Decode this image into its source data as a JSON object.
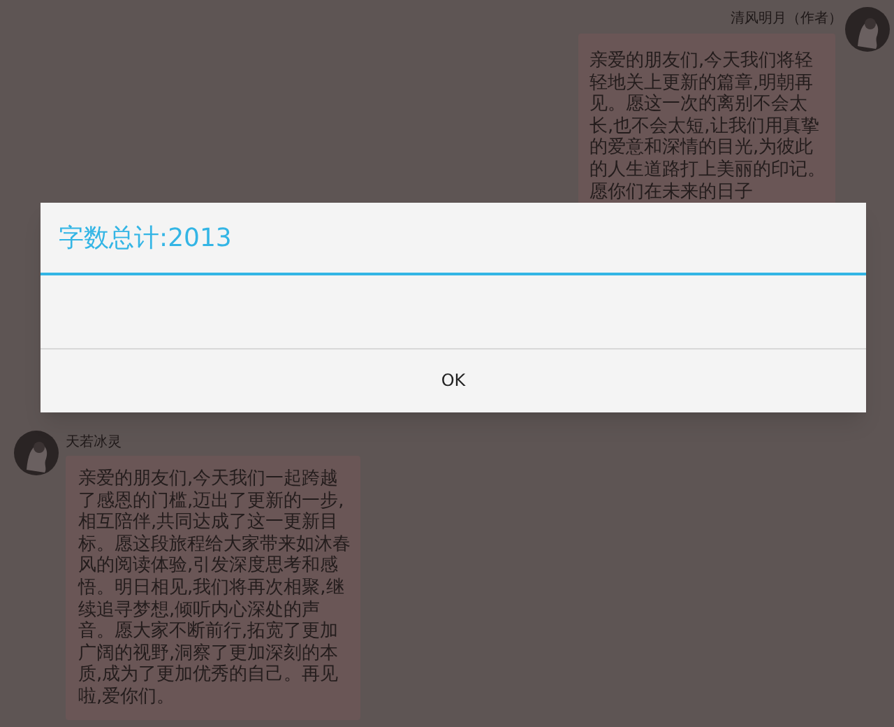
{
  "messages": [
    {
      "kind": "outgoing",
      "author": "清风明月（作者）",
      "text": "亲爱的朋友们,今天我们将轻轻地关上更新的篇章,明朝再见。愿这一次的离别不会太长,也不会太短,让我们用真挚的爱意和深情的目光,为彼此的人生道路打上美丽的印记。愿你们在未来的日子"
    },
    {
      "kind": "incoming",
      "author": "天若冰灵",
      "text": "亲爱的朋友们,今天我们一起跨越了感恩的门槛,迈出了更新的一步,相互陪伴,共同达成了这一更新目标。愿这段旅程给大家带来如沐春风的阅读体验,引发深度思考和感悟。明日相见,我们将再次相聚,继续追寻梦想,倾听内心深处的声音。愿大家不断前行,拓宽了更加广阔的视野,洞察了更加深刻的本质,成为了更加优秀的自己。再见啦,爱你们。"
    }
  ],
  "dialog": {
    "title": "字数总计:2013",
    "button": "OK"
  }
}
